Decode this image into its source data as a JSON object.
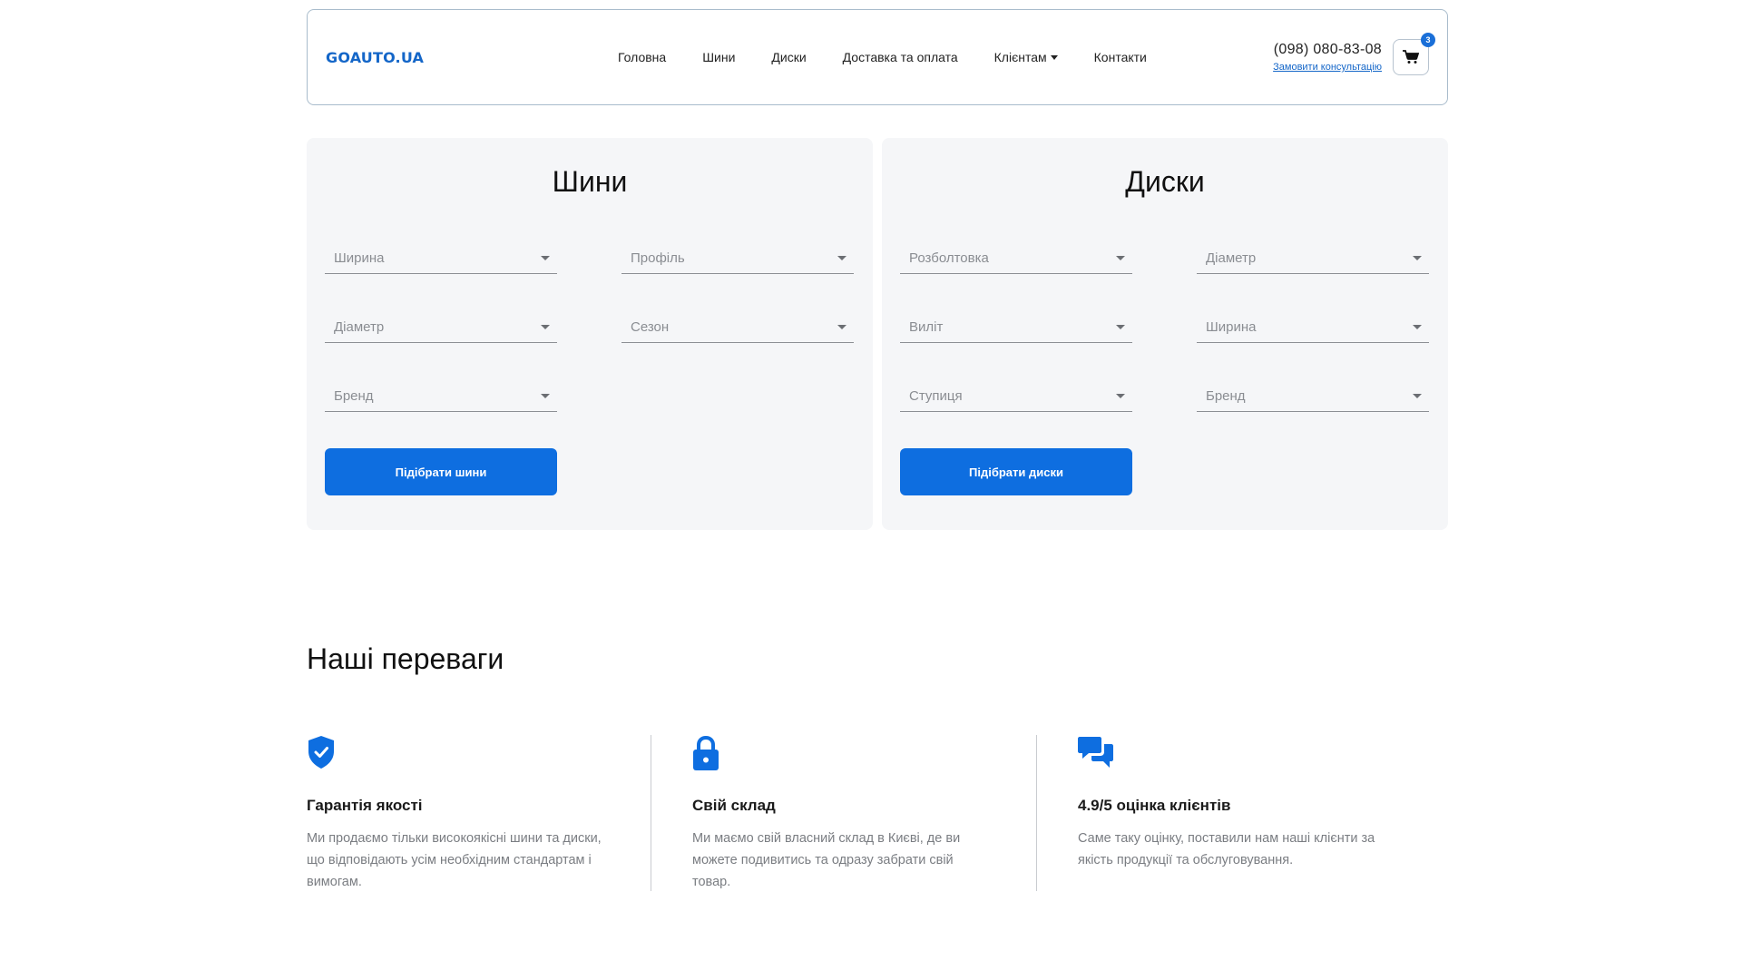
{
  "header": {
    "logo": "GOAUTO.UA",
    "nav": [
      "Головна",
      "Шини",
      "Диски",
      "Доставка та оплата",
      "Клієнтам",
      "Контакти"
    ],
    "phone": "(098) 080-83-08",
    "consult_link": "Замовити консультацію",
    "cart_count": "3"
  },
  "tires": {
    "title": "Шини",
    "fields": [
      "Ширина",
      "Профіль",
      "Діаметр",
      "Сезон",
      "Бренд"
    ],
    "button": "Підібрати шини"
  },
  "wheels": {
    "title": "Диски",
    "fields": [
      "Розболтовка",
      "Діаметр",
      "Виліт",
      "Ширина",
      "Ступиця",
      "Бренд"
    ],
    "button": "Підібрати диски"
  },
  "advantages": {
    "title": "Наші переваги",
    "items": [
      {
        "icon": "shield-check-icon",
        "title": "Гарантія якості",
        "text": "Ми продаємо тільки високоякісні шини та диски, що відповідають усім необхідним стандартам і вимогам."
      },
      {
        "icon": "lock-icon",
        "title": "Свій склад",
        "text": "Ми маємо свій власний склад в Києві, де ви можете подивитись та одразу забрати свій товар."
      },
      {
        "icon": "chat-bubbles-icon",
        "title": "4.9/5 оцінка клієнтів",
        "text": "Саме таку оцінку, поставили нам наші клієнти за якість продукції та обслуговування."
      }
    ]
  },
  "colors": {
    "accent": "#0e6ee0",
    "panel_bg": "#f5f6f8",
    "logo": "#1466c8"
  }
}
